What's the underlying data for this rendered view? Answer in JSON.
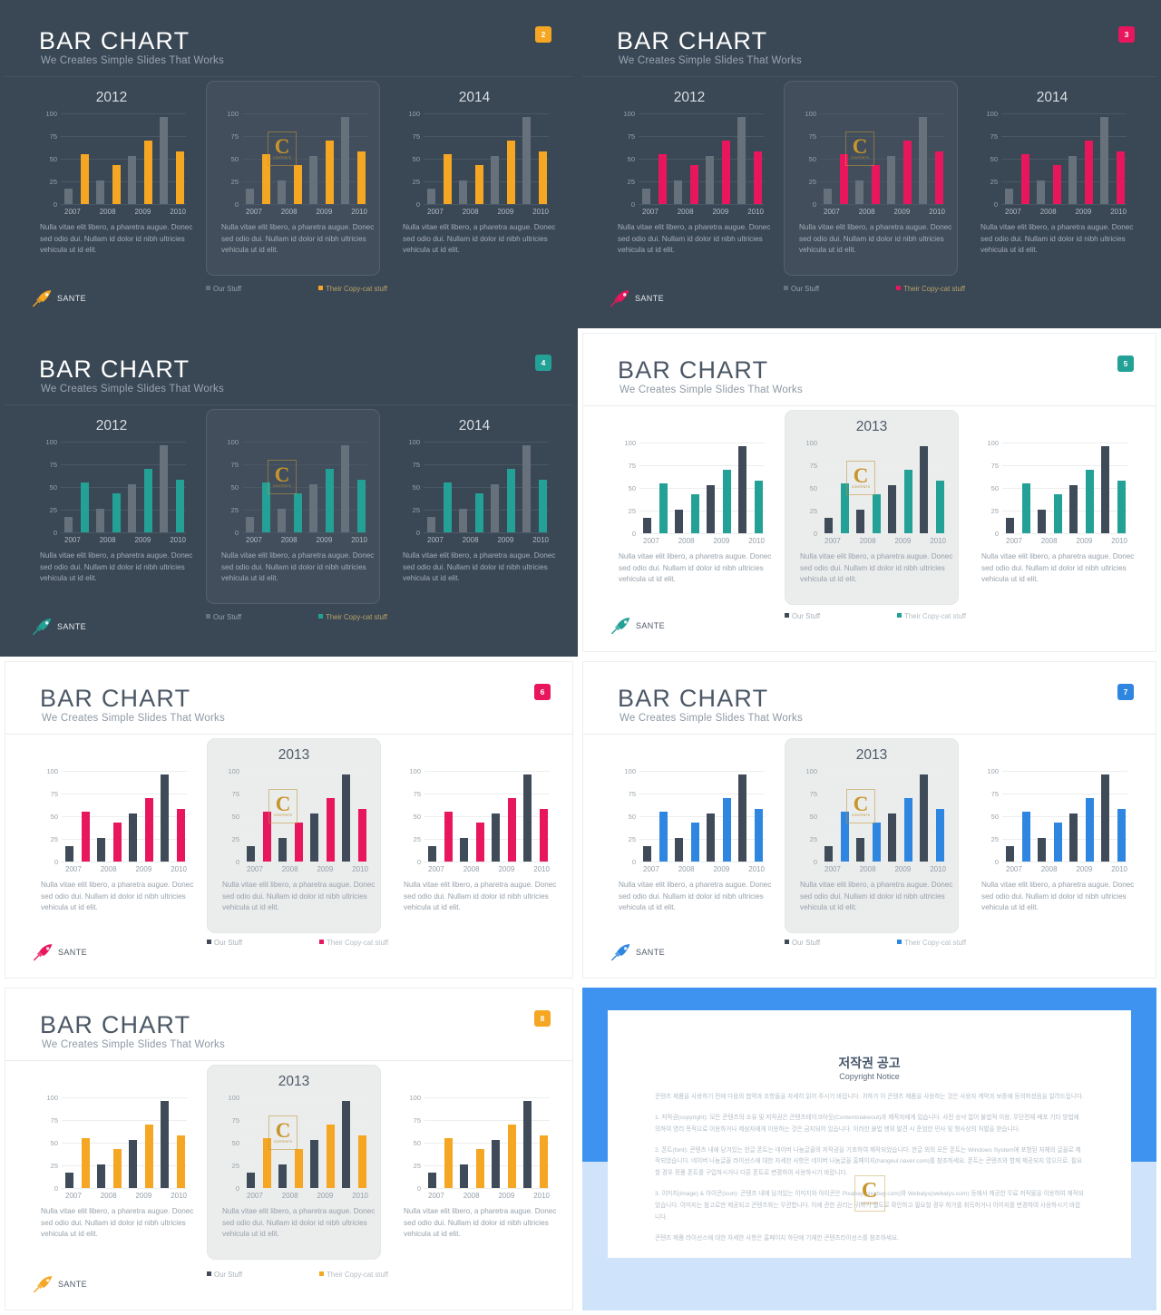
{
  "deck": {
    "title": "BAR CHART",
    "subtitle": "We Creates Simple Slides That Works",
    "brand_name": "SANTE",
    "blurb": "Nulla vitae elit libero, a pharetra augue. Donec sed odio dui. Nullam id dolor id nibh ultricies vehicula ut id elit.",
    "legend": {
      "our": "Our Stuff",
      "their": "Their Copy-cat stuff"
    },
    "watermark": {
      "letter": "C",
      "caption": "CONTENTS"
    }
  },
  "chart_data": {
    "type": "bar",
    "title": "BAR CHART",
    "categories": [
      "2007",
      "2008",
      "2009",
      "2010"
    ],
    "series": [
      {
        "name": "Our Stuff",
        "values": [
          17,
          26,
          53,
          96
        ]
      },
      {
        "name": "Their Copy-cat stuff",
        "values": [
          55,
          43,
          70,
          58
        ]
      }
    ],
    "ylim": [
      0,
      100
    ],
    "yticks": [
      0,
      25,
      50,
      75,
      100
    ],
    "xlabel": "",
    "ylabel": "",
    "grid": true,
    "legend_position": "bottom"
  },
  "slides": [
    {
      "number": "2",
      "theme": "dark",
      "accent": "#f5a623",
      "our_color": "#66717c",
      "badge": "#f5a623",
      "years": [
        "2012",
        "",
        "2014"
      ]
    },
    {
      "number": "3",
      "theme": "dark",
      "accent": "#e8175d",
      "our_color": "#66717c",
      "badge": "#e8175d",
      "years": [
        "2012",
        "",
        "2014"
      ]
    },
    {
      "number": "4",
      "theme": "dark",
      "accent": "#23a196",
      "our_color": "#66717c",
      "badge": "#23a196",
      "years": [
        "2012",
        "",
        "2014"
      ]
    },
    {
      "number": "5",
      "theme": "light",
      "accent": "#23a196",
      "our_color": "#3f4b59",
      "badge": "#23a196",
      "years": [
        "",
        "2013",
        ""
      ]
    },
    {
      "number": "6",
      "theme": "light",
      "accent": "#e8175d",
      "our_color": "#3f4b59",
      "badge": "#e8175d",
      "years": [
        "",
        "2013",
        ""
      ]
    },
    {
      "number": "7",
      "theme": "light",
      "accent": "#2f86e0",
      "our_color": "#3f4b59",
      "badge": "#2f86e0",
      "years": [
        "",
        "2013",
        ""
      ]
    },
    {
      "number": "8",
      "theme": "light",
      "accent": "#f5a623",
      "our_color": "#3f4b59",
      "badge": "#f5a623",
      "years": [
        "",
        "2013",
        ""
      ]
    }
  ],
  "copyright": {
    "title_ko": "저작권 공고",
    "title_en": "Copyright Notice",
    "paragraphs": [
      "콘텐츠 제품을 사용하기 전에 다음의 협약과 조항들을 자세히 읽어 주시기 바랍니다. 귀하가 이 콘텐츠 제품을 사용하는 것은 사용자 계약과 보증에 동의하셨음을 알려드립니다.",
      "1. 저작권(copyright): 모든 콘텐츠의 소유 및 저작권은 콘텐츠테이크아웃(Contentstakeout)과 제작자에게 있습니다. 사전 승낙 없이 불법적 이용, 무단전재·배포 기타 방법에 의하여 영리 목적으로 이용하거나 제삼자에게 이용하는 것은 금지되어 있습니다. 이러한 불법 행위 발견 시 준엄한 민사 및 형사상의 처벌을 받습니다.",
      "2. 폰트(font): 콘텐츠 내에 담겨있는 한글 폰트는 네이버 나눔글꼴의 저작권을 기초하여 제작되었습니다. 한글 외의 모든 폰트는 Windows System에 포함된 자체의 글꼴로 제작되었습니다. 네이버 나눔글꼴 라이선스에 대한 자세한 사항은 네이버 나눔글꼴 홈페이지(hangeul.naver.com)를 참조하세요. 폰트는 콘텐츠와 함께 제공되지 않으므로, 필요할 경우 정품 폰트를 구입하시거나 다른 폰트로 변경하여 사용하시기 바랍니다.",
      "3. 이미지(image) & 아이콘(icon): 콘텐츠 내에 담겨있는 이미지와 아이콘은 Pixabay(pixabay.com)와 Webalys(webalys.com) 등에서 제공한 무료 저작물을 이용하여 제작되었습니다. 이미지는 참고로만 제공되고 콘텐츠와는 무관합니다. 이에 관한 권리는 귀하가 별도로 확인하고 필요할 경우 허가를 취득하거나 이미지를 변경하여 사용하시기 바랍니다.",
      "콘텐츠 제품 라이선스에 대한 자세한 사항은 홈페이지 하단에 기재한 콘텐츠라이선스를 참조하세요."
    ]
  }
}
